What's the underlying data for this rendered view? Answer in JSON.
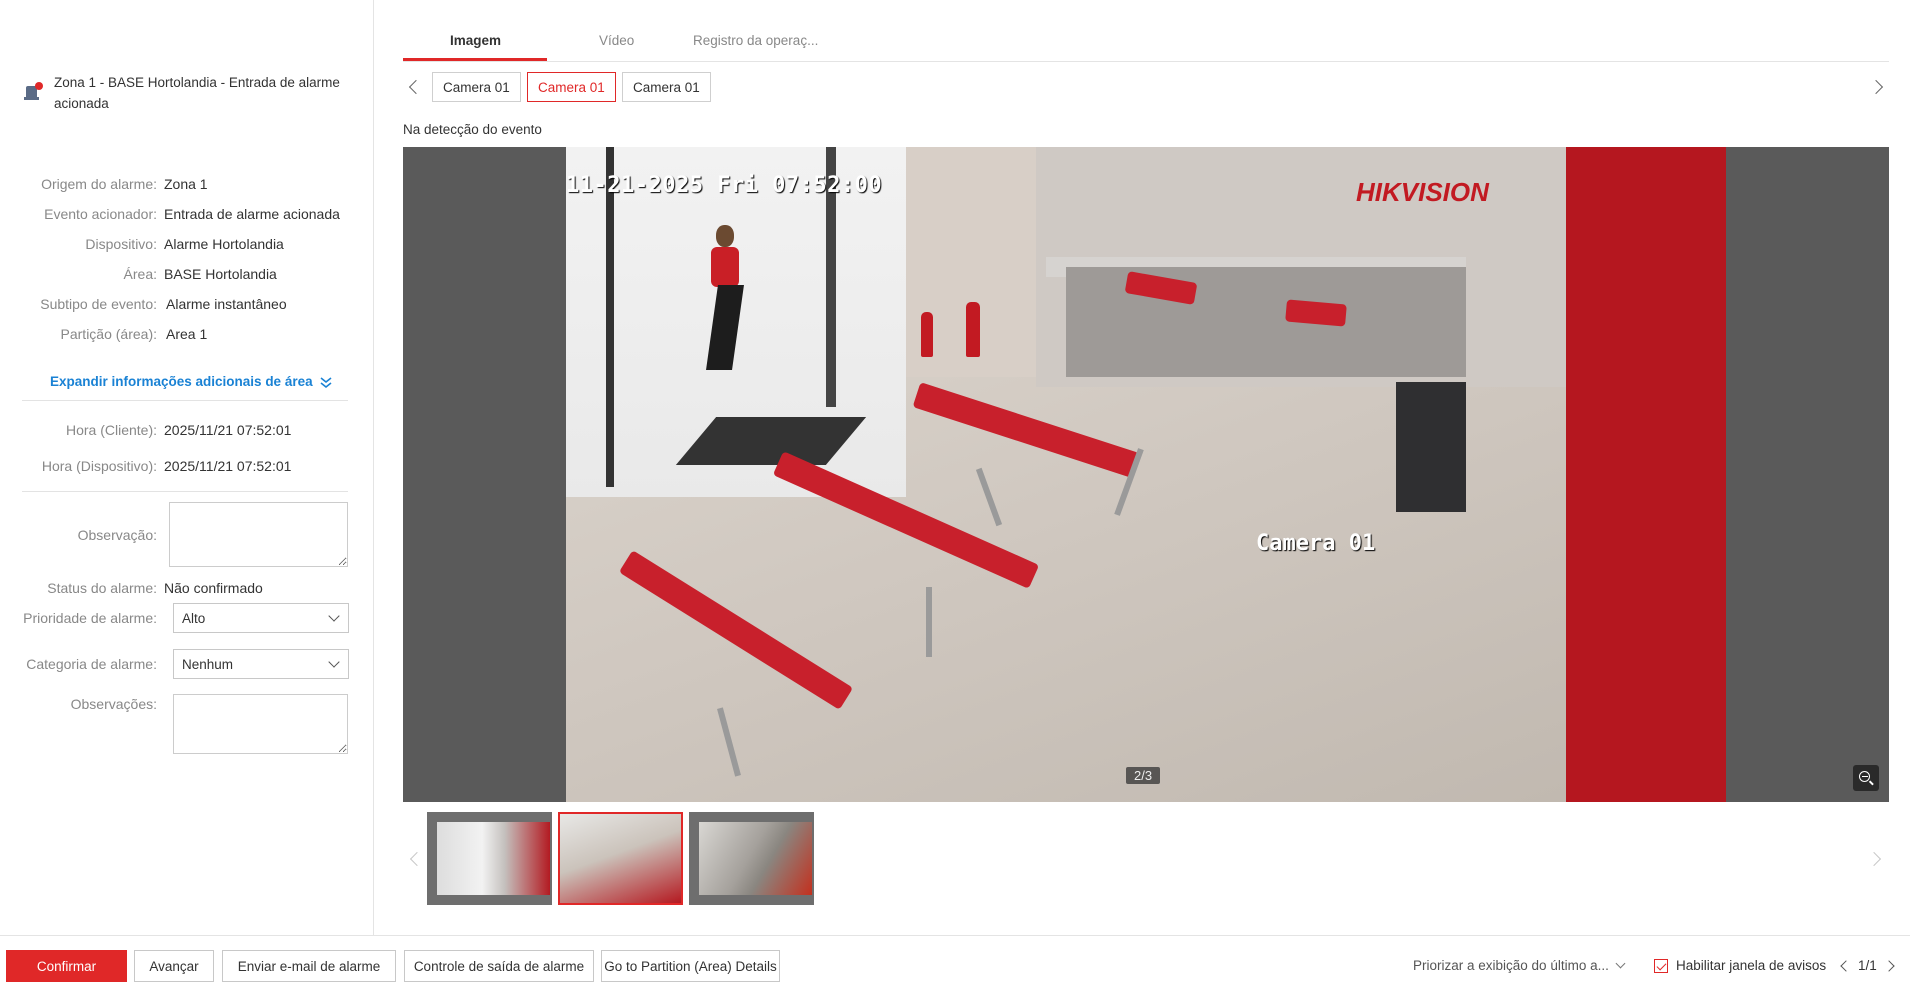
{
  "alarm": {
    "title_line1": "Zona 1 - BASE Hortolandia - Entrada de alarme",
    "title_line2": "acionada",
    "icon": "alarm-device-icon"
  },
  "details": [
    {
      "label": "Origem do alarme:",
      "value": "Zona 1"
    },
    {
      "label": "Evento acionador:",
      "value": "Entrada de alarme acionada"
    },
    {
      "label": "Dispositivo:",
      "value": "Alarme Hortolandia"
    },
    {
      "label": "Área:",
      "value": "BASE Hortolandia"
    },
    {
      "label": "Subtipo de evento:",
      "value": "Alarme instantâneo"
    },
    {
      "label": "Partição (área):",
      "value": "Area 1"
    }
  ],
  "expand_label": "Expandir informações adicionais de área",
  "times": [
    {
      "label": "Hora (Cliente):",
      "value": "2025/11/21 07:52:01"
    },
    {
      "label": "Hora (Dispositivo):",
      "value": "2025/11/21 07:52:01"
    }
  ],
  "form": {
    "observation_label": "Observação:",
    "observation_value": "",
    "status_label": "Status do alarme:",
    "status_value": "Não confirmado",
    "priority_label": "Prioridade de alarme:",
    "priority_value": "Alto",
    "category_label": "Categoria de alarme:",
    "category_value": "Nenhum",
    "notes_label": "Observações:",
    "notes_value": ""
  },
  "tabs": [
    {
      "label": "Imagem",
      "active": true
    },
    {
      "label": "Vídeo",
      "active": false
    },
    {
      "label": "Registro da operaç...",
      "active": false
    }
  ],
  "cameras": [
    {
      "label": "Camera 01",
      "selected": false
    },
    {
      "label": "Camera 01",
      "selected": true
    },
    {
      "label": "Camera 01",
      "selected": false
    }
  ],
  "detect_label": "Na detecção do evento",
  "viewer": {
    "osd_datetime": "11-21-2025 Fri 07:52:00",
    "osd_camera": "Camera 01",
    "brand": "HIKVISION",
    "page_indicator": "2/3"
  },
  "thumbnails_selected_index": 1,
  "bottom": {
    "confirm": "Confirmar",
    "advance": "Avançar",
    "email": "Enviar e-mail de alarme",
    "output": "Controle de saída de alarme",
    "partition": "Go to Partition (Area) Details",
    "priority_display": "Priorizar a exibição do último a...",
    "enable_window": "Habilitar janela de avisos",
    "enable_window_checked": true,
    "pager": "1/1"
  },
  "colors": {
    "accent": "#e02828",
    "link": "#1a82d4"
  }
}
